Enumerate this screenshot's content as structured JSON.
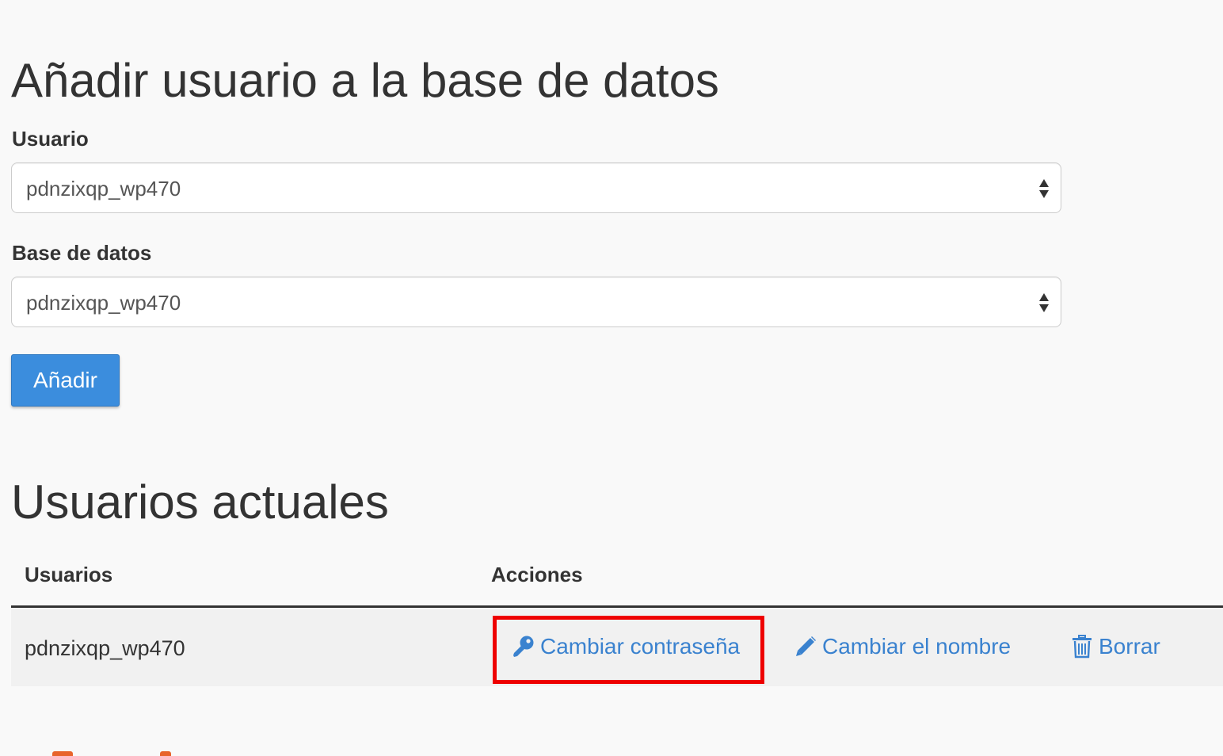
{
  "add_section": {
    "title": "Añadir usuario a la base de datos",
    "user_label": "Usuario",
    "user_value": "pdnzixqp_wp470",
    "database_label": "Base de datos",
    "database_value": "pdnzixqp_wp470",
    "add_button_label": "Añadir"
  },
  "current_section": {
    "title": "Usuarios actuales",
    "table": {
      "columns": [
        "Usuarios",
        "Acciones"
      ],
      "rows": [
        {
          "user": "pdnzixqp_wp470",
          "actions": {
            "change_password": "Cambiar contraseña",
            "rename": "Cambiar el nombre",
            "delete": "Borrar"
          }
        }
      ]
    }
  },
  "icons": {
    "change_password": "key-icon",
    "rename": "pencil-icon",
    "delete": "trash-icon",
    "select": "updown-arrows-icon"
  },
  "colors": {
    "primary_button": "#3b8ddd",
    "link": "#3a82cf",
    "highlight": "#ee0000",
    "background": "#f9f9f9"
  }
}
